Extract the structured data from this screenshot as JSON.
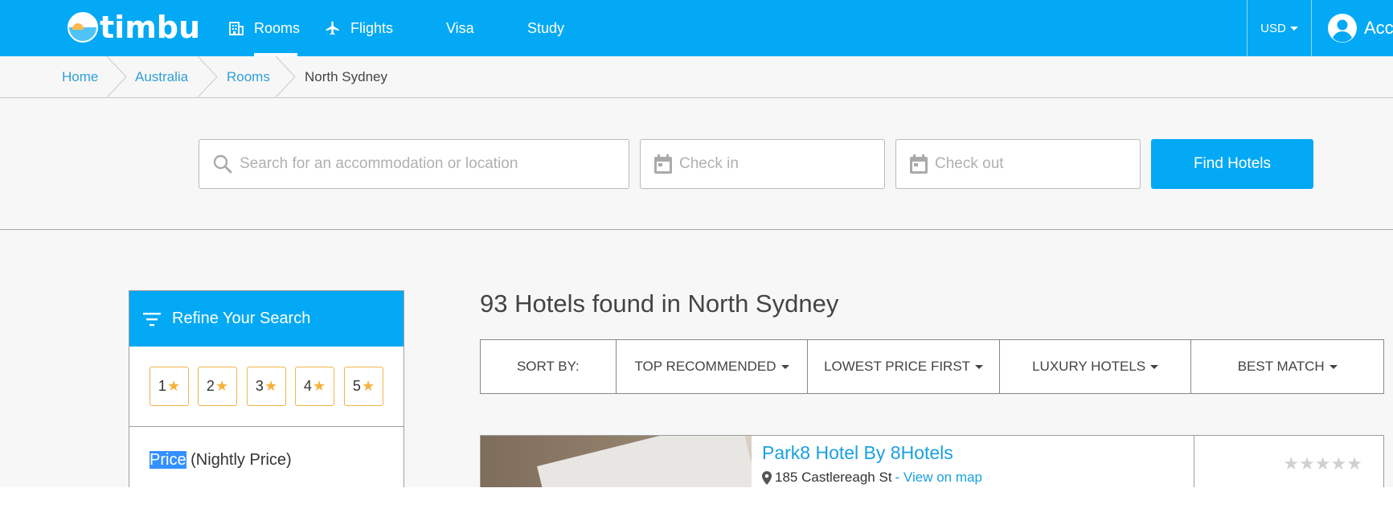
{
  "brand": {
    "name": "timbu"
  },
  "nav": {
    "rooms": "Rooms",
    "flights": "Flights",
    "visa": "Visa",
    "study": "Study"
  },
  "currency": "USD",
  "account": "Acco",
  "breadcrumb": {
    "home": "Home",
    "country": "Australia",
    "section": "Rooms",
    "current": "North Sydney"
  },
  "search": {
    "placeholder": "Search for an accommodation or location",
    "checkin_placeholder": "Check in",
    "checkout_placeholder": "Check out",
    "button": "Find Hotels"
  },
  "sidebar": {
    "heading": "Refine Your Search",
    "star_filters": [
      "1",
      "2",
      "3",
      "4",
      "5"
    ],
    "price_label": "Price",
    "price_suffix": "(Nightly Price)"
  },
  "results": {
    "title": "93 Hotels found in North Sydney",
    "sort": {
      "label": "SORT BY:",
      "options": [
        "TOP RECOMMENDED",
        "LOWEST PRICE FIRST",
        "LUXURY HOTELS",
        "BEST MATCH"
      ]
    },
    "hotels": [
      {
        "name": "Park8 Hotel By 8Hotels",
        "address": "185 Castlereagh St",
        "map_link": "- View on map",
        "rating_stars": 0,
        "rating_max": 5
      }
    ]
  },
  "colors": {
    "primary": "#03a9f4",
    "link": "#1aa0e0",
    "star": "#f4b23a",
    "background": "#f7f7f7"
  }
}
